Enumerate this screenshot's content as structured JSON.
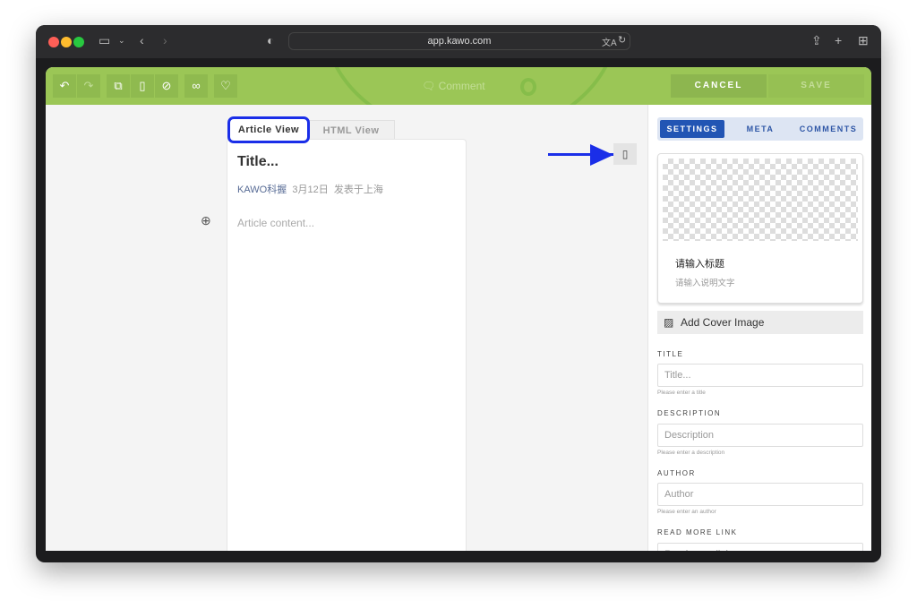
{
  "browser": {
    "url": "app.kawo.com"
  },
  "toolbar": {
    "comment_label": "Comment",
    "cancel_label": "CANCEL",
    "save_label": "SAVE",
    "accent": "#9bc656"
  },
  "editor": {
    "tabs": [
      {
        "label": "Article View",
        "active": true
      },
      {
        "label": "HTML View",
        "active": false
      }
    ],
    "title_placeholder": "Title...",
    "author": "KAWO科握",
    "date": "3月12日",
    "location": "发表于上海",
    "content_placeholder": "Article content..."
  },
  "panel": {
    "tabs": [
      {
        "label": "SETTINGS",
        "active": true
      },
      {
        "label": "META"
      },
      {
        "label": "COMMENTS"
      }
    ],
    "cover": {
      "title": "请输入标题",
      "description": "请输入说明文字",
      "add_label": "Add Cover Image"
    },
    "fields": [
      {
        "label": "TITLE",
        "placeholder": "Title...",
        "hint": "Please enter a title"
      },
      {
        "label": "DESCRIPTION",
        "placeholder": "Description",
        "hint": "Please enter a description"
      },
      {
        "label": "AUTHOR",
        "placeholder": "Author",
        "hint": "Please enter an author"
      },
      {
        "label": "READ MORE LINK",
        "placeholder": "Read more link"
      }
    ]
  },
  "annotation": {
    "highlight_color": "#1a2ee8"
  }
}
